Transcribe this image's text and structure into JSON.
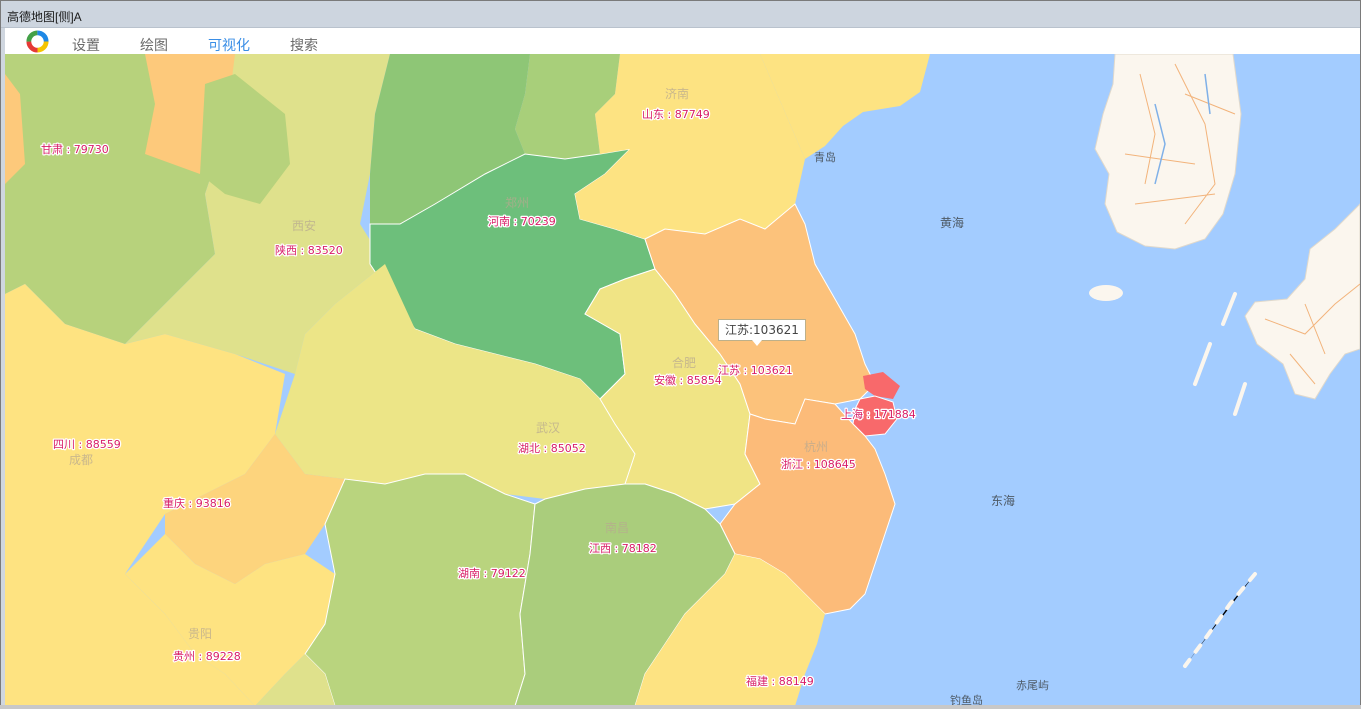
{
  "window": {
    "title": "高德地图[侧]A"
  },
  "menu": {
    "logo_icon": "colorful-ring-logo-icon",
    "items": [
      {
        "label": "设置",
        "active": false
      },
      {
        "label": "绘图",
        "active": false
      },
      {
        "label": "可视化",
        "active": true
      },
      {
        "label": "搜索",
        "active": false
      }
    ]
  },
  "map": {
    "provinces": [
      {
        "name": "甘肃",
        "value": 79730,
        "label": "甘肃 : 79730",
        "color": "#b7d27c"
      },
      {
        "name": "陕西",
        "value": 83520,
        "label": "陕西 : 83520",
        "color": "#dfe18c"
      },
      {
        "name": "河南",
        "value": 70239,
        "label": "河南 : 70239",
        "color": "#6dbf7b"
      },
      {
        "name": "山东",
        "value": 87749,
        "label": "山东 : 87749",
        "color": "#fde382"
      },
      {
        "name": "江苏",
        "value": 103621,
        "label": "江苏 : 103621",
        "color": "#fcc27b"
      },
      {
        "name": "安徽",
        "value": 85854,
        "label": "安徽 : 85854",
        "color": "#f0e485"
      },
      {
        "name": "湖北",
        "value": 85052,
        "label": "湖北 : 85052",
        "color": "#ece587"
      },
      {
        "name": "四川",
        "value": 88559,
        "label": "四川 : 88559",
        "color": "#fee381"
      },
      {
        "name": "重庆",
        "value": 93816,
        "label": "重庆 : 93816",
        "color": "#fdd47d"
      },
      {
        "name": "上海",
        "value": 171884,
        "label": "上海 : 171884",
        "color": "#f8696b"
      },
      {
        "name": "浙江",
        "value": 108645,
        "label": "浙江 : 108645",
        "color": "#fcbb79"
      },
      {
        "name": "湖南",
        "value": 79122,
        "label": "湖南 : 79122",
        "color": "#b9d47e"
      },
      {
        "name": "江西",
        "value": 78182,
        "label": "江西 : 78182",
        "color": "#aacd7c"
      },
      {
        "name": "贵州",
        "value": 89228,
        "label": "贵州 : 89228",
        "color": "#fee381"
      },
      {
        "name": "福建",
        "value": 88149,
        "label": "福建 : 88149",
        "color": "#fde382"
      },
      {
        "name": "宁夏",
        "value": null,
        "label": "",
        "color": "#a8cf7a"
      },
      {
        "name": "山西",
        "value": null,
        "label": "",
        "color": "#8ec676"
      }
    ],
    "tooltip": "江苏:103621",
    "seas": [
      "黄海",
      "东海"
    ],
    "places": [
      "郑州",
      "武汉",
      "杭州",
      "南昌",
      "西安",
      "成都",
      "贵阳",
      "济南",
      "合肥",
      "青岛",
      "钓鱼岛",
      "赤尾屿"
    ],
    "colors": {
      "sea": "#a3ccff",
      "land_foreign": "#fbf6ee",
      "road": "#f0a35e",
      "label": "#d81e67"
    }
  }
}
